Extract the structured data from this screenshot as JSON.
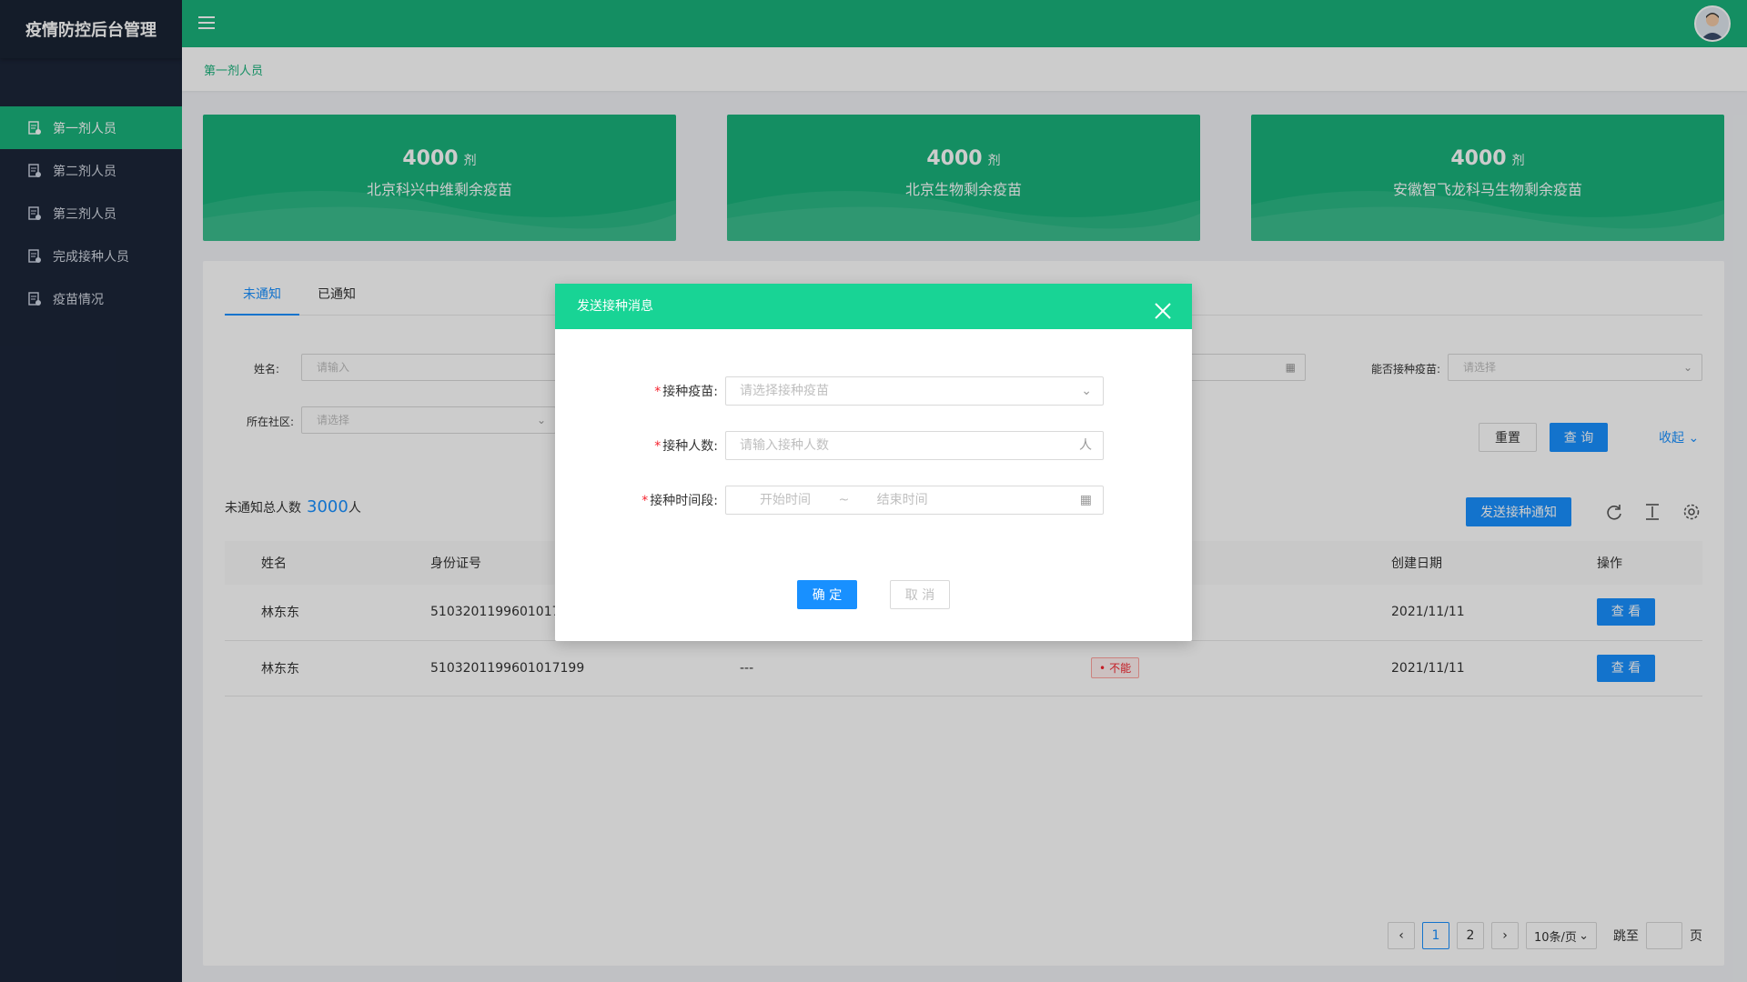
{
  "app": {
    "title": "疫情防控后台管理"
  },
  "sidebar": {
    "items": [
      {
        "label": "第一剂人员",
        "active": true
      },
      {
        "label": "第二剂人员",
        "active": false
      },
      {
        "label": "第三剂人员",
        "active": false
      },
      {
        "label": "完成接种人员",
        "active": false
      },
      {
        "label": "疫苗情况",
        "active": false
      }
    ]
  },
  "breadcrumb": "第一剂人员",
  "cards": [
    {
      "value": "4000",
      "unit": "剂",
      "label": "北京科兴中维剩余疫苗"
    },
    {
      "value": "4000",
      "unit": "剂",
      "label": "北京生物剩余疫苗"
    },
    {
      "value": "4000",
      "unit": "剂",
      "label": "安徽智飞龙科马生物剩余疫苗"
    }
  ],
  "tabs": [
    "未通知",
    "已通知"
  ],
  "filters": {
    "name_label": "姓名:",
    "name_placeholder": "请输入",
    "community_label": "所在社区:",
    "community_placeholder": "请选择",
    "vaccine_label": "能否接种疫苗:",
    "vaccine_placeholder": "请选择",
    "reset": "重置",
    "query": "查 询",
    "collapse": "收起"
  },
  "summary": {
    "label": "未通知总人数",
    "count": "3000",
    "unit": "人"
  },
  "toolbar": {
    "send_notice": "发送接种通知"
  },
  "table": {
    "columns": [
      "姓名",
      "身份证号",
      "",
      "",
      "创建日期",
      "操作"
    ],
    "rows": [
      {
        "name": "林东东",
        "id": "5103201199601017199",
        "col3": "",
        "tag": "",
        "date": "2021/11/11",
        "action": "查 看"
      },
      {
        "name": "林东东",
        "id": "5103201199601017199",
        "col3": "---",
        "tag": "不能",
        "date": "2021/11/11",
        "action": "查 看"
      }
    ]
  },
  "pagination": {
    "pages": [
      "1",
      "2"
    ],
    "current": "1",
    "page_size": "10条/页",
    "jump_label": "跳至",
    "page_label": "页"
  },
  "modal": {
    "title": "发送接种消息",
    "vaccine_label": "接种疫苗:",
    "vaccine_placeholder": "请选择接种疫苗",
    "count_label": "接种人数:",
    "count_placeholder": "请输入接种人数",
    "count_suffix": "人",
    "period_label": "接种时间段:",
    "start_placeholder": "开始时间",
    "range_sep": "~",
    "end_placeholder": "结束时间",
    "ok": "确 定",
    "cancel": "取 消"
  },
  "colors": {
    "primary_green": "#19b27b",
    "modal_green": "#18d495",
    "blue": "#1890ff",
    "sidebar_bg": "#1c2639"
  }
}
